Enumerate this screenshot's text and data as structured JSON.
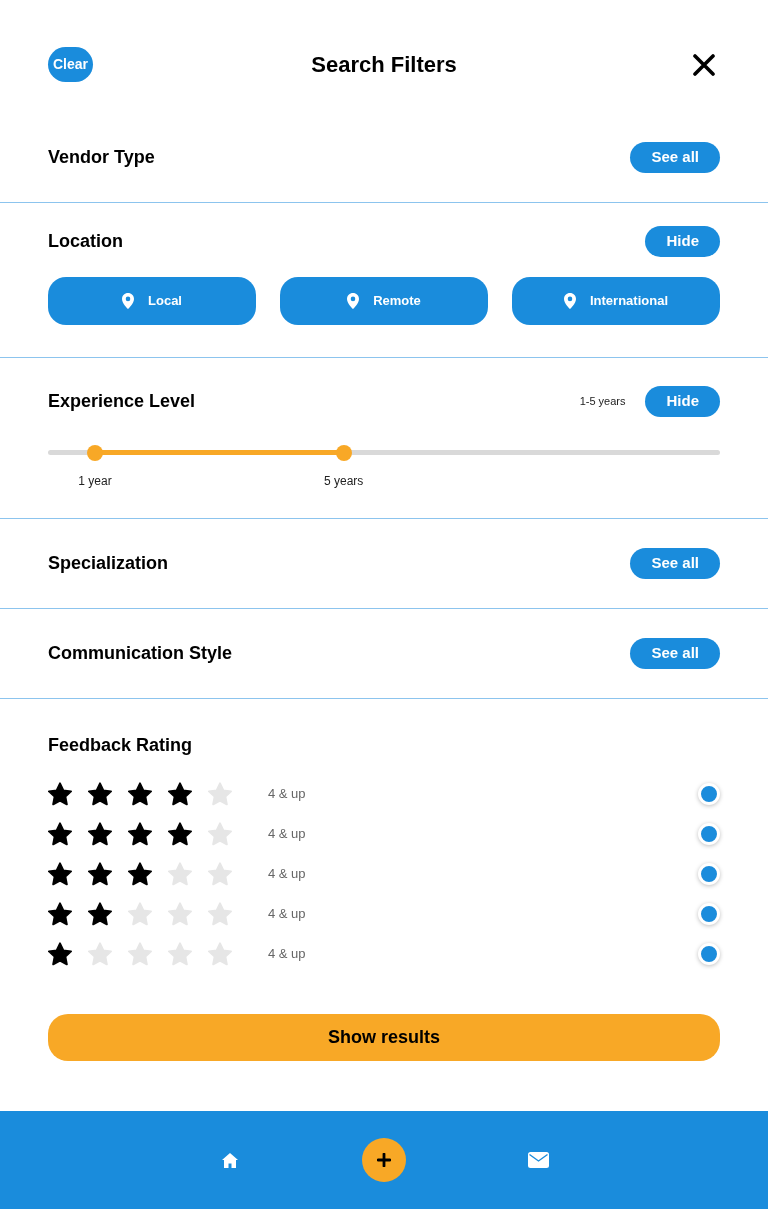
{
  "header": {
    "clear": "Clear",
    "title": "Search Filters"
  },
  "sections": [
    {
      "kind": "collapsed",
      "title": "Vendor Type",
      "toggle": "See all"
    },
    {
      "kind": "chips",
      "title": "Location",
      "toggle": "Hide",
      "options": [
        "Local",
        "Remote",
        "International"
      ]
    },
    {
      "kind": "range",
      "title": "Experience Level",
      "summary": "1-5 years",
      "toggle": "Hide",
      "thumbs": [
        {
          "level": 0.07,
          "label": "1 year"
        },
        {
          "level": 0.44,
          "label": "5 years"
        }
      ]
    },
    {
      "kind": "collapsed",
      "title": "Specialization",
      "toggle": "See all"
    },
    {
      "kind": "collapsed",
      "title": "Communication Style",
      "toggle": "See all"
    },
    {
      "kind": "rating",
      "title": "Feedback Rating",
      "rows": [
        {
          "stars": 4,
          "label": "4 & up",
          "selected": true
        },
        {
          "stars": 4,
          "label": "4 & up",
          "selected": true
        },
        {
          "stars": 3,
          "label": "4 & up",
          "selected": true
        },
        {
          "stars": 2,
          "label": "4 & up",
          "selected": true
        },
        {
          "stars": 1,
          "label": "4 & up",
          "selected": true
        }
      ]
    }
  ],
  "show_results": "Show results"
}
